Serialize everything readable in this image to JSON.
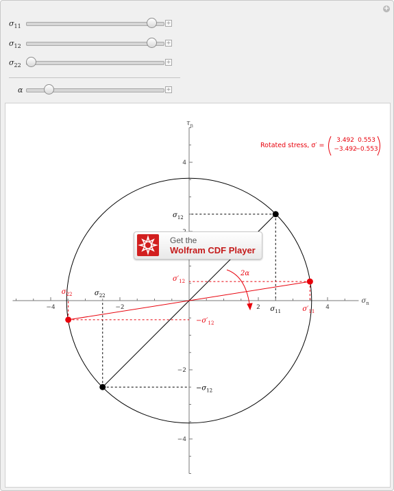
{
  "controls": {
    "sliders": [
      {
        "symbol": "σ",
        "subscript": "11",
        "value_fraction": 0.95
      },
      {
        "symbol": "σ",
        "subscript": "12",
        "value_fraction": 0.95
      },
      {
        "symbol": "σ",
        "subscript": "22",
        "value_fraction": 0.0
      },
      {
        "symbol": "α",
        "subscript": "",
        "value_fraction": 0.14
      }
    ],
    "plus_symbol": "+"
  },
  "cdf_badge": {
    "line1": "Get the",
    "line2": "Wolfram CDF Player"
  },
  "chart_data": {
    "type": "scatter",
    "x_axis_label": "σn",
    "y_axis_label": "τn",
    "xlim": [
      -5.1,
      4.9
    ],
    "ylim": [
      -5.0,
      5.0
    ],
    "x_ticks": [
      -4,
      -2,
      2,
      4
    ],
    "y_ticks": [
      4,
      2,
      -2,
      -4
    ],
    "circle": {
      "center": [
        0,
        0
      ],
      "radius": 3.54
    },
    "original_points": {
      "color": "#000000",
      "points": [
        [
          2.5,
          2.5
        ],
        [
          -2.5,
          -2.5
        ]
      ]
    },
    "rotated_points": {
      "color": "#e8000b",
      "points": [
        [
          3.492,
          0.553
        ],
        [
          -3.492,
          -0.553
        ]
      ]
    },
    "axis_labels": {
      "sigma11": "σ11",
      "sigma12": "σ12",
      "minus_sigma12": "−σ12",
      "sigma22": "σ22",
      "sigma11_rot": "σ′11",
      "sigma12_rot": "σ′12",
      "minus_sigma12_rot": "−σ′12",
      "sigma22_rot": "σ22",
      "angle": "2α"
    },
    "matrix": {
      "title": "Rotated stress, σ′ =",
      "rows": [
        [
          "3.492",
          "0.553"
        ],
        [
          "−3.492",
          "−0.553"
        ]
      ]
    }
  }
}
